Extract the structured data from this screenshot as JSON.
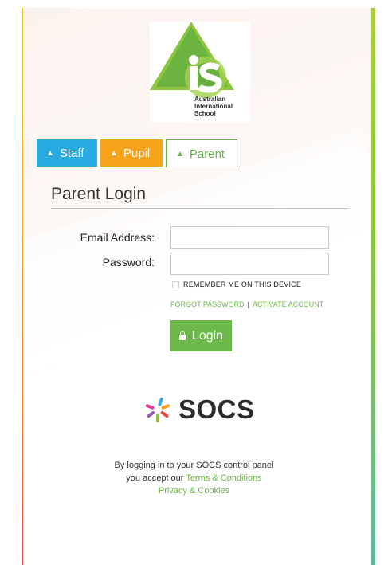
{
  "logo": {
    "lines": [
      "Australian",
      "International",
      "School"
    ],
    "mark": "is"
  },
  "tabs": [
    {
      "label": "Staff",
      "color": "#29abe2"
    },
    {
      "label": "Pupil",
      "color": "#f7a21b"
    },
    {
      "label": "Parent",
      "color": "#67b34a"
    }
  ],
  "login": {
    "title": "Parent Login",
    "email_label": "Email Address:",
    "email_value": "",
    "password_label": "Password:",
    "password_value": "",
    "remember_label": "REMEMBER ME ON THIS DEVICE",
    "forgot_link": "FORGOT PASSWORD",
    "separator": "|",
    "activate_link": "ACTIVATE ACCOUNT",
    "button_label": "Login"
  },
  "brand": {
    "name": "SOCS"
  },
  "footer": {
    "line1": "By logging in to your SOCS control panel",
    "line2_prefix": "you accept our",
    "terms_link": "Terms & Conditions",
    "privacy_link": "Privacy & Cookies"
  },
  "colors": {
    "accent_green": "#6cb84a",
    "staff_blue": "#29abe2",
    "pupil_orange": "#f7a21b"
  }
}
